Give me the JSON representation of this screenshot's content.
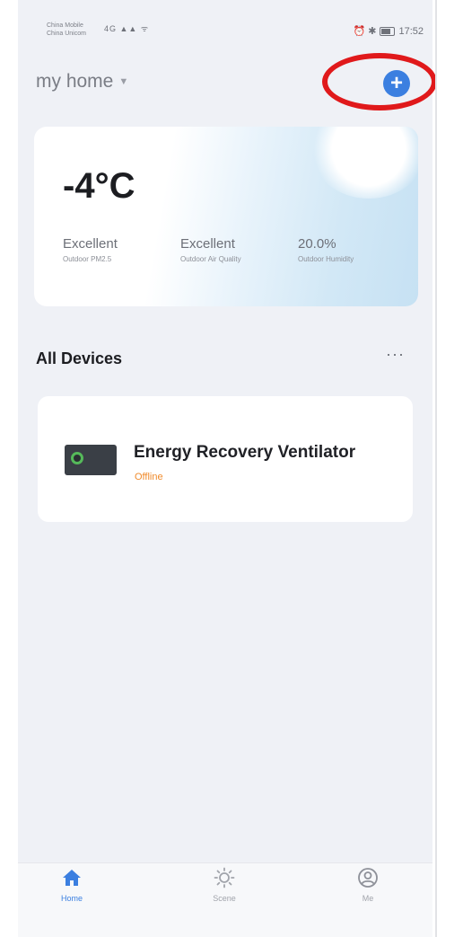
{
  "status_bar": {
    "carrier_line1": "China Mobile",
    "carrier_line2": "China Unicom",
    "signal_text": "4G ▲▲ ᯤ",
    "right_icons": "⏰ ✱",
    "time": "17:52"
  },
  "header": {
    "home_name": "my home",
    "home_caret": "▼",
    "add_icon_glyph": "+"
  },
  "weather": {
    "temperature": "-4°C",
    "metrics": [
      {
        "value": "Excellent",
        "label": "Outdoor PM2.5"
      },
      {
        "value": "Excellent",
        "label": "Outdoor Air Quality"
      },
      {
        "value": "20.0%",
        "label": "Outdoor Humidity"
      }
    ]
  },
  "devices_section": {
    "title": "All Devices",
    "more_glyph": "···"
  },
  "devices": [
    {
      "name": "Energy Recovery Ventilator",
      "status": "Offline"
    }
  ],
  "bottom_nav": {
    "items": [
      {
        "label": "Home",
        "icon": "home-icon"
      },
      {
        "label": "Scene",
        "icon": "scene-icon"
      },
      {
        "label": "Me",
        "icon": "profile-icon"
      }
    ]
  },
  "colors": {
    "accent": "#3b7fe0",
    "offline": "#f08b2c",
    "annotation_ring": "#e0191b",
    "background": "#eff1f6"
  }
}
